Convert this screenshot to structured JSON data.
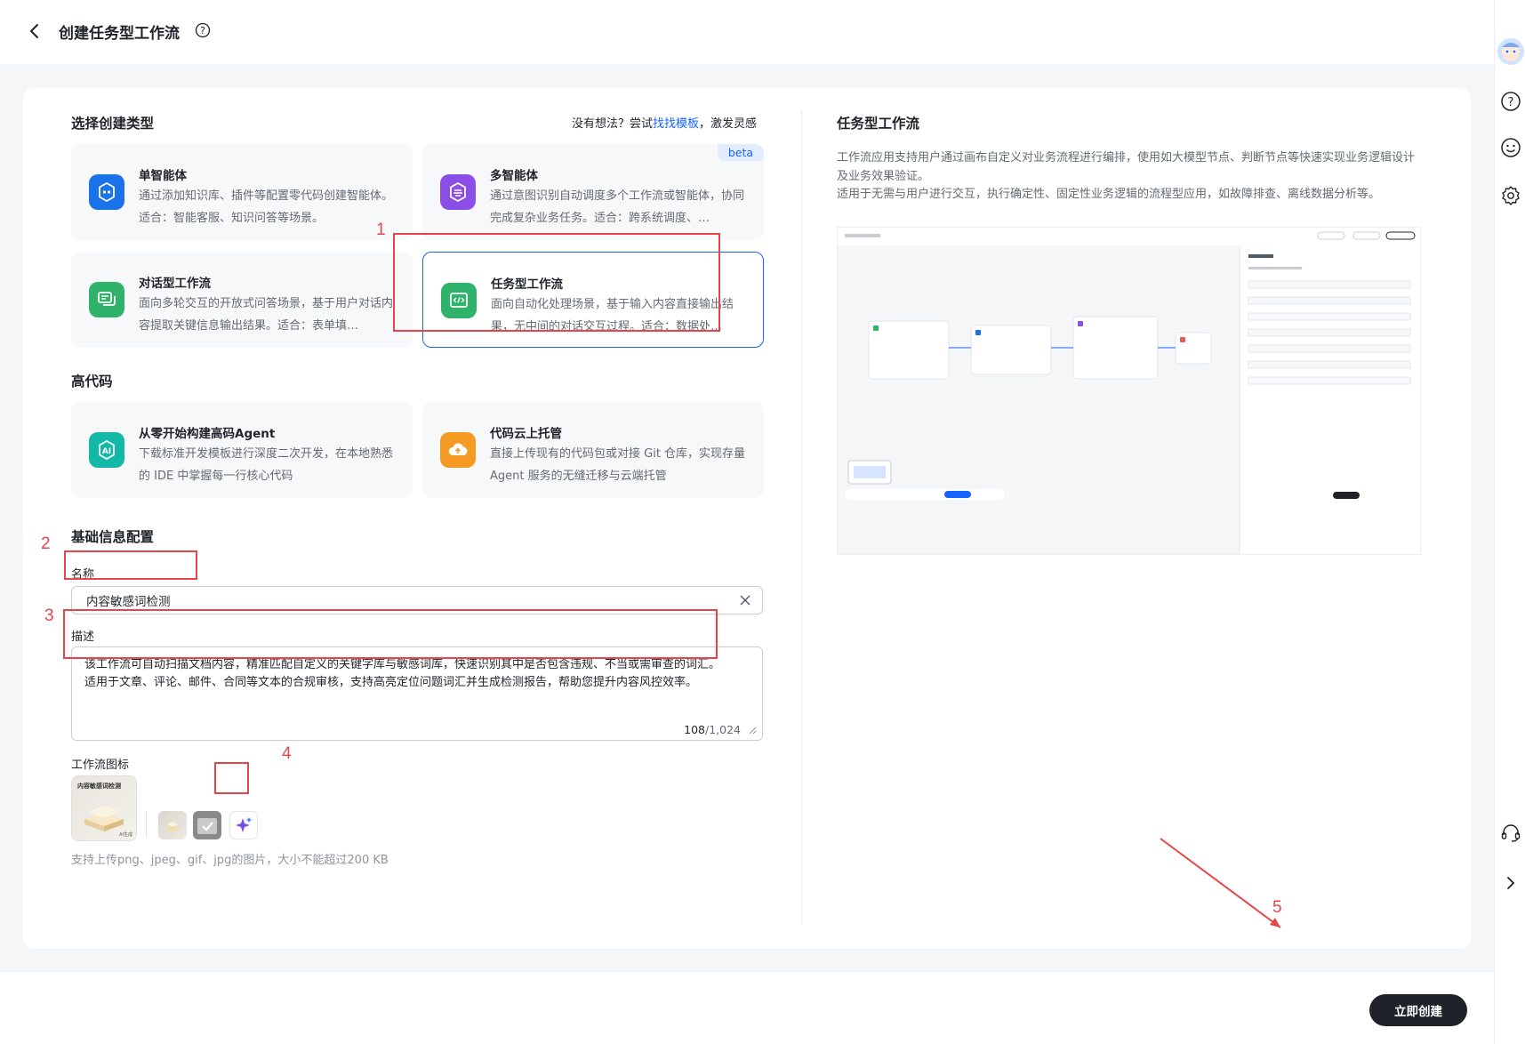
{
  "header": {
    "title": "创建任务型工作流"
  },
  "left": {
    "section_type_title": "选择创建类型",
    "hint_prefix": "没有想法？尝试",
    "hint_link": "找找模板",
    "hint_suffix": "，激发灵感",
    "types": [
      {
        "title": "单智能体",
        "desc": "通过添加知识库、插件等配置零代码创建智能体。适合：智能客服、知识问答等场景。"
      },
      {
        "title": "多智能体",
        "desc": "通过意图识别自动调度多个工作流或智能体，协同完成复杂业务任务。适合：跨系统调度、…",
        "badge": "beta"
      },
      {
        "title": "对话型工作流",
        "desc": "面向多轮交互的开放式问答场景，基于用户对话内容提取关键信息输出结果。适合：表单填…"
      },
      {
        "title": "任务型工作流",
        "desc": "面向自动化处理场景，基于输入内容直接输出结果，无中间的对话交互过程。适合：数据处…"
      }
    ],
    "section_code_title": "高代码",
    "code_types": [
      {
        "title": "从零开始构建高码Agent",
        "desc": "下载标准开发模板进行深度二次开发，在本地熟悉的 IDE 中掌握每一行核心代码"
      },
      {
        "title": "代码云上托管",
        "desc": "直接上传现有的代码包或对接 Git 仓库，实现存量 Agent 服务的无缝迁移与云端托管"
      }
    ],
    "section_basic_title": "基础信息配置",
    "name_label": "名称",
    "name_value": "内容敏感词检测",
    "desc_label": "描述",
    "desc_line1": "该工作流可自动扫描文档内容，精准匹配自定义的关键字库与敏感词库，快速识别其中是否包含违规、不当或需审查的词汇。",
    "desc_line2": "适用于文章、评论、邮件、合同等文本的合规审核，支持高亮定位问题词汇并生成检测报告，帮助您提升内容风控效率。",
    "desc_count": "108",
    "desc_max": "/1,024",
    "icon_label": "工作流图标",
    "icon_preview_text": "内容敏感词检测",
    "icon_preview_tag": "AI生成",
    "upload_hint": "支持上传png、jpeg、gif、jpg的图片，大小不能超过200 KB"
  },
  "right": {
    "title": "任务型工作流",
    "desc1": "工作流应用支持用户通过画布自定义对业务流程进行编排，使用如大模型节点、判断节点等快速实现业务逻辑设计及业务效果验证。",
    "desc2": "适用于无需与用户进行交互，执行确定性、固定性业务逻辑的流程型应用，如故障排查、离线数据分析等。"
  },
  "annotations": [
    "1",
    "2",
    "3",
    "4",
    "5"
  ],
  "footer": {
    "create_label": "立即创建"
  },
  "colors": {
    "accent": "#1664ff",
    "annotation": "#e8454a",
    "primary_button": "#1f2329"
  }
}
